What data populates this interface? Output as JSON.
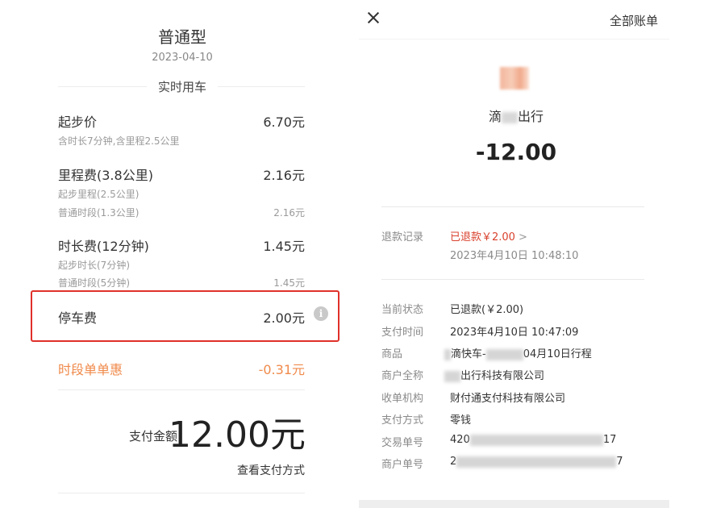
{
  "left": {
    "title": "普通型",
    "date": "2023-04-10",
    "section_label": "实时用车",
    "fees": [
      {
        "label": "起步价",
        "amount": "6.70元",
        "subs": [
          {
            "label": "含时长7分钟,含里程2.5公里",
            "amount": ""
          }
        ]
      },
      {
        "label": "里程费(3.8公里)",
        "amount": "2.16元",
        "subs": [
          {
            "label": "起步里程(2.5公里)",
            "amount": ""
          },
          {
            "label": "普通时段(1.3公里)",
            "amount": "2.16元"
          }
        ]
      },
      {
        "label": "时长费(12分钟)",
        "amount": "1.45元",
        "subs": [
          {
            "label": "起步时长(7分钟)",
            "amount": ""
          },
          {
            "label": "普通时段(5分钟)",
            "amount": "1.45元"
          }
        ]
      },
      {
        "label": "停车费",
        "amount": "2.00元"
      }
    ],
    "discount": {
      "label": "时段单单惠",
      "amount": "-0.31元"
    },
    "pay_label": "支付金额",
    "pay_amount": "12.00元",
    "pay_link": "查看支付方式",
    "info_icon": "info-circle-icon",
    "highlight_color": "#e0302a",
    "discount_color": "#f08a4b"
  },
  "right": {
    "close_icon": "close-icon",
    "all_bills": "全部账单",
    "merchant_left": "滴",
    "merchant_right": "出行",
    "amount": "-12.00",
    "refund": {
      "key": "退款记录",
      "value": "已退款￥2.00",
      "time": "2023年4月10日 10:48:10"
    },
    "details": [
      {
        "key": "当前状态",
        "value": "已退款(￥2.00)"
      },
      {
        "key": "支付时间",
        "value": "2023年4月10日 10:47:09"
      },
      {
        "key": "商品",
        "value_a": "滴快车-",
        "value_b": "04月10日行程"
      },
      {
        "key": "商户全称",
        "value": "出行科技有限公司"
      },
      {
        "key": "收单机构",
        "value": "财付通支付科技有限公司"
      },
      {
        "key": "支付方式",
        "value": "零钱"
      },
      {
        "key": "交易单号",
        "value_a": "420",
        "value_b": "17"
      },
      {
        "key": "商户单号",
        "value_a": "2",
        "value_b": "7"
      }
    ],
    "refund_color": "#d9412d"
  }
}
